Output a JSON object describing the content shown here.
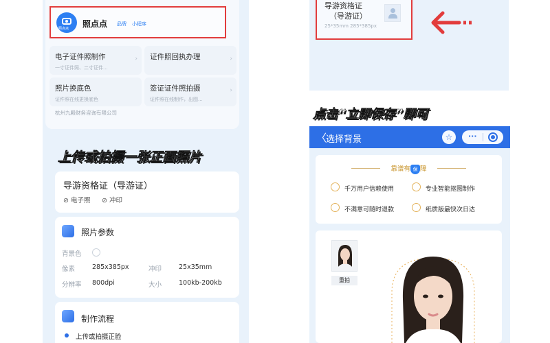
{
  "left": {
    "app": {
      "name": "照点点",
      "badge_brand": "品牌",
      "badge_mini": "小程序",
      "icon_tag": "照点点"
    },
    "services": [
      {
        "title": "电子证件照制作",
        "sub": "一寸证件照、二寸证件..."
      },
      {
        "title": "证件照回执办理",
        "sub": ""
      },
      {
        "title": "照片换底色",
        "sub": "证件照在线更换底色"
      },
      {
        "title": "签证证件照拍摄",
        "sub": "证件照在线制作，出图..."
      }
    ],
    "company": "杭州九殿财务咨询有限公司",
    "banner": "上传或拍摄一张正面照片",
    "cert": {
      "title": "导游资格证（导游证）",
      "opt1": "电子照",
      "opt2": "冲印"
    },
    "params": {
      "title": "照片参数",
      "bg_label": "背景色",
      "pixel_label": "像素",
      "pixel_value": "285x385px",
      "print_label": "冲印",
      "print_value": "25x35mm",
      "dpi_label": "分辨率",
      "dpi_value": "800dpi",
      "size_label": "大小",
      "size_value": "100kb-200kb"
    },
    "process": {
      "title": "制作流程",
      "step1": "上传或拍摄正脸"
    }
  },
  "right": {
    "top_card": {
      "title_line1": "导游资格证",
      "title_line2": "（导游证）",
      "size": "25*35mm 285*385px"
    },
    "banner": "点击“立即保存”即可",
    "nav": {
      "back": "〈",
      "title": "选择背景",
      "star": "☆",
      "dots": "···"
    },
    "guarantee": {
      "head_left": "靠谱有",
      "head_badge": "保",
      "head_right": "障",
      "items": [
        "千万用户信赖使用",
        "专业智能抠图制作",
        "不满意可随时退款",
        "纸质版最快次日达"
      ]
    },
    "thumb_label": "重拍"
  },
  "colors": {
    "accent": "#2d6fe6",
    "highlight_red": "#e23c3c",
    "banner_yellow": "#f3df4d",
    "gold": "#c9962f"
  },
  "icons": [
    "camera-icon",
    "chevron-right-icon",
    "check-circle-icon",
    "params-icon",
    "process-icon",
    "red-arrow-icon",
    "back-icon",
    "star-icon",
    "more-icon",
    "record-icon",
    "shield-icon",
    "user-placeholder-icon"
  ]
}
